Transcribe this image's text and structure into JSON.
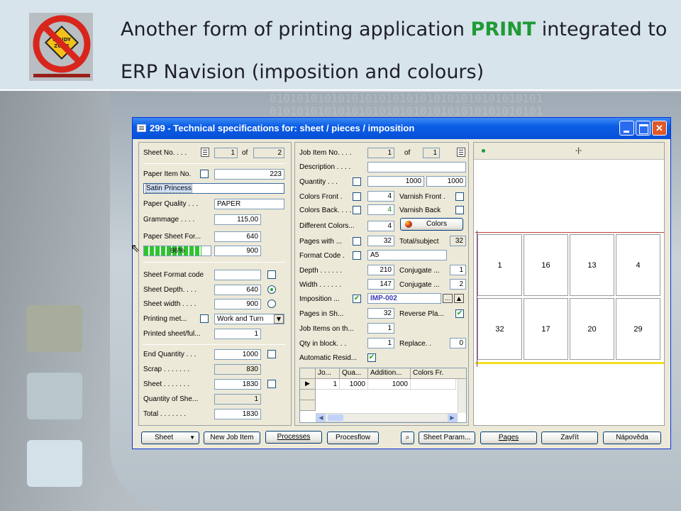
{
  "slide": {
    "title_before": "Another form of printing application ",
    "title_keyword": "PRINT",
    "title_after": "  integrated to ERP Navision (imposition and colours)",
    "logo_text": "STUDY ZONE",
    "binary_text": "0101010101010101010101010101010101010101",
    "accent_color": "#1f9a34"
  },
  "window": {
    "title": "299 - Technical specifications for: sheet / pieces / imposition"
  },
  "sheet_pane": {
    "sheet_no_label": "Sheet No. . . .",
    "sheet_no": "1",
    "of_label": "of",
    "sheet_total": "2",
    "paper_item_no_label": "Paper Item No.",
    "paper_item_no": "223",
    "paper_name": "Satin Princess",
    "paper_quality_label": "Paper Quality . . .",
    "paper_quality": "PAPER",
    "grammage_label": "Grammage . . . .",
    "grammage": "115,00",
    "paper_sheet_format_label": "Paper Sheet For...",
    "paper_sheet_w": "640",
    "paper_sheet_h": "900",
    "progress_text": "86%",
    "progress_value": 0.86,
    "sheet_format_code_label": "Sheet Format code",
    "sheet_depth_label": "Sheet Depth. . . .",
    "sheet_depth": "640",
    "sheet_width_label": "Sheet width . . . .",
    "sheet_width": "900",
    "printing_method_label": "Printing met...",
    "printing_method": "Work and Turn",
    "printed_sheet_label": "Printed sheet/ful...",
    "printed_sheet": "1",
    "end_quantity_label": "End Quantity . . .",
    "end_quantity": "1000",
    "scrap_label": "Scrap . . . . . . .",
    "scrap": "830",
    "sheet_label": "Sheet . . . . . . .",
    "sheet": "1830",
    "quantity_of_sheets_label": "Quantity of She...",
    "quantity_of_sheets": "1",
    "total_label": "Total . . . . . . .",
    "total": "1830"
  },
  "job_pane": {
    "job_item_no_label": "Job Item No. . . .",
    "job_item_no": "1",
    "of_label": "of",
    "job_item_total": "1",
    "description_label": "Description . . . .",
    "description": "",
    "quantity_label": "Quantity . . .",
    "quantity_a": "1000",
    "quantity_b": "1000",
    "colors_front_label": "Colors Front .",
    "colors_front": "4",
    "varnish_front_label": "Varnish Front .",
    "colors_back_label": "Colors Back. . . .",
    "colors_back": "4",
    "varnish_back_label": "Varnish Back",
    "different_colors_label": "Different Colors...",
    "different_colors": "4",
    "colors_button": "Colors",
    "pages_with_label": "Pages with ...",
    "pages_with": "32",
    "total_subject_label": "Total/subject",
    "total_subject": "32",
    "format_code_label": "Format Code .",
    "format_code": "A5",
    "depth_label": "Depth . . . . . .",
    "depth": "210",
    "conjugate1_label": "Conjugate ...",
    "conjugate1": "1",
    "width_label": "Width . . . . . .",
    "width": "147",
    "conjugate2_label": "Conjugate ...",
    "conjugate2": "2",
    "imposition_label": "Imposition ...",
    "imposition": "IMP-002",
    "pages_in_sheet_label": "Pages in Sh...",
    "pages_in_sheet": "32",
    "reverse_plate_label": "Reverse Pla...",
    "job_items_on_label": "Job Items on th...",
    "job_items_on": "1",
    "qty_in_block_label": "Qty in block. . .",
    "qty_in_block": "1",
    "replace_label": "Replace. .",
    "replace": "0",
    "automatic_residue_label": "Automatic Resid..."
  },
  "grid": {
    "headers": [
      "Jo...",
      "Qua...",
      "Addition...",
      "Colors Fr."
    ],
    "rows": [
      [
        "1",
        "1000",
        "1000",
        ""
      ]
    ]
  },
  "imposition_view": {
    "marker": "-|-",
    "top_row": [
      "1",
      "16",
      "13",
      "4"
    ],
    "bottom_row": [
      "32",
      "17",
      "20",
      "29"
    ]
  },
  "buttons": {
    "sheet": "Sheet",
    "new_job_item": "New Job Item",
    "processes": "Processes",
    "procesflow": "Procesflow",
    "sheet_param": "Sheet Param...",
    "pages": "Pages",
    "zavrit": "Zavřít",
    "napoveda": "Nápověda"
  }
}
